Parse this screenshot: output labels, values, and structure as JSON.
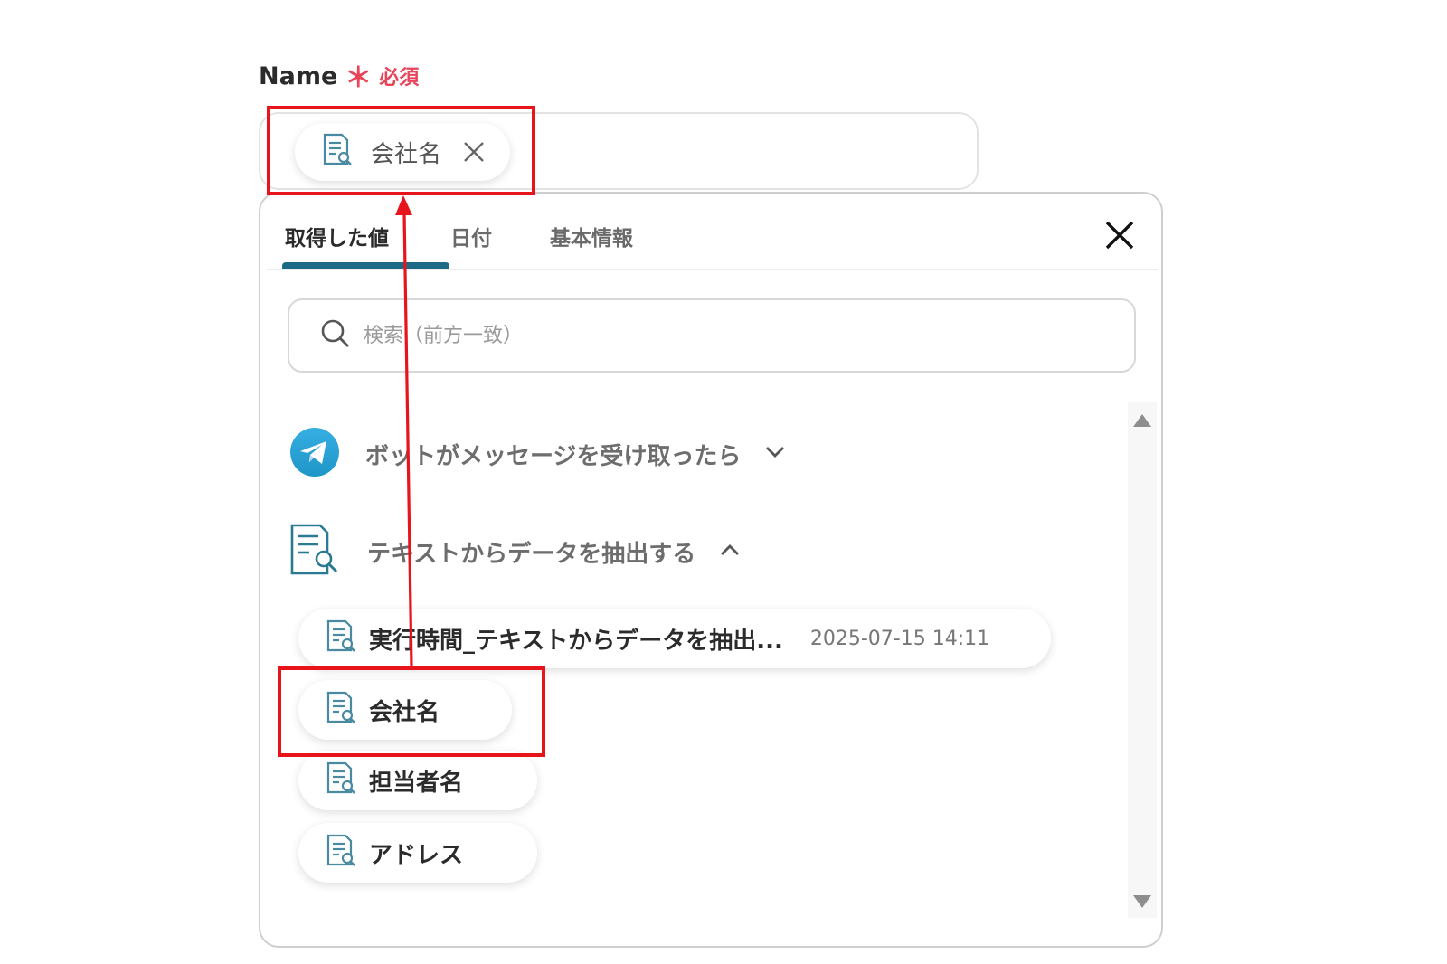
{
  "field": {
    "label": "Name",
    "required_mark": "＊",
    "required_text": "必須",
    "selected_chip": "会社名"
  },
  "popup": {
    "tabs": [
      {
        "label": "取得した値",
        "active": true
      },
      {
        "label": "日付",
        "active": false
      },
      {
        "label": "基本情報",
        "active": false
      }
    ],
    "search_placeholder": "検索（前方一致）",
    "sections": [
      {
        "label": "ボットがメッセージを受け取ったら",
        "icon": "telegram-icon",
        "expanded": false
      },
      {
        "label": "テキストからデータを抽出する",
        "icon": "document-search-icon",
        "expanded": true
      }
    ],
    "items": [
      {
        "label": "実行時間_テキストからデータを抽出...",
        "timestamp": "2025-07-15 14:11"
      },
      {
        "label": "会社名"
      },
      {
        "label": "担当者名"
      },
      {
        "label": "アドレス"
      }
    ]
  },
  "colors": {
    "accent": "#1c6a85",
    "required": "#e8455a",
    "annotation": "#e8141b",
    "telegram": "#2aa3dd"
  }
}
